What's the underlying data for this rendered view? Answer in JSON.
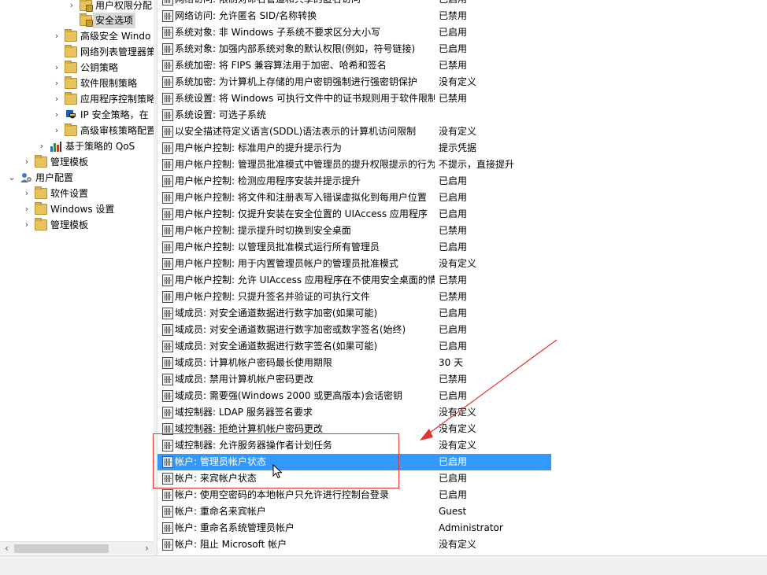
{
  "tree": {
    "items": [
      {
        "label": "用户权限分配",
        "chevron": "›",
        "icon": "lock-folder-icon"
      },
      {
        "label": "安全选项",
        "chevron": "",
        "icon": "lock-folder-icon",
        "selected": true
      },
      {
        "label": "高级安全 Windo",
        "chevron": "›",
        "icon": "folder-icon"
      },
      {
        "label": "网络列表管理器策",
        "chevron": "",
        "icon": "folder-icon"
      },
      {
        "label": "公钥策略",
        "chevron": "›",
        "icon": "folder-icon"
      },
      {
        "label": "软件限制策略",
        "chevron": "›",
        "icon": "folder-icon"
      },
      {
        "label": "应用程序控制策略",
        "chevron": "›",
        "icon": "folder-icon"
      },
      {
        "label": "IP 安全策略，在",
        "chevron": "›",
        "icon": "ipsec-shield-icon"
      },
      {
        "label": "高级审核策略配置",
        "chevron": "›",
        "icon": "folder-icon"
      },
      {
        "label": "基于策略的 QoS",
        "chevron": "›",
        "icon": "qos-chart-icon"
      },
      {
        "label": "管理模板",
        "chevron": "›",
        "icon": "folder-icon"
      },
      {
        "label": "用户配置",
        "chevron": "⌄",
        "icon": "user-config-icon"
      },
      {
        "label": "软件设置",
        "chevron": "›",
        "icon": "folder-icon"
      },
      {
        "label": "Windows 设置",
        "chevron": "›",
        "icon": "folder-icon"
      },
      {
        "label": "管理模板",
        "chevron": "›",
        "icon": "folder-icon"
      }
    ],
    "scroll_left": "‹",
    "scroll_right": "›"
  },
  "policies": [
    {
      "name": "网络访问: 限制对命名管道和共享的匿名访问",
      "value": "已启用"
    },
    {
      "name": "网络访问: 允许匿名 SID/名称转换",
      "value": "已禁用"
    },
    {
      "name": "系统对象: 非 Windows 子系统不要求区分大小写",
      "value": "已启用"
    },
    {
      "name": "系统对象: 加强内部系统对象的默认权限(例如，符号链接)",
      "value": "已启用"
    },
    {
      "name": "系统加密: 将 FIPS 兼容算法用于加密、哈希和签名",
      "value": "已禁用"
    },
    {
      "name": "系统加密: 为计算机上存储的用户密钥强制进行强密钥保护",
      "value": "没有定义"
    },
    {
      "name": "系统设置: 将 Windows 可执行文件中的证书规则用于软件限制策略",
      "value": "已禁用"
    },
    {
      "name": "系统设置: 可选子系统",
      "value": ""
    },
    {
      "name": "以安全描述符定义语言(SDDL)语法表示的计算机访问限制",
      "value": "没有定义"
    },
    {
      "name": "用户帐户控制: 标准用户的提升提示行为",
      "value": "提示凭据"
    },
    {
      "name": "用户帐户控制: 管理员批准模式中管理员的提升权限提示的行为",
      "value": "不提示，直接提升"
    },
    {
      "name": "用户帐户控制: 检测应用程序安装并提示提升",
      "value": "已启用"
    },
    {
      "name": "用户帐户控制: 将文件和注册表写入错误虚拟化到每用户位置",
      "value": "已启用"
    },
    {
      "name": "用户帐户控制: 仅提升安装在安全位置的 UIAccess 应用程序",
      "value": "已启用"
    },
    {
      "name": "用户帐户控制: 提示提升时切换到安全桌面",
      "value": "已禁用"
    },
    {
      "name": "用户帐户控制: 以管理员批准模式运行所有管理员",
      "value": "已启用"
    },
    {
      "name": "用户帐户控制: 用于内置管理员帐户的管理员批准模式",
      "value": "没有定义"
    },
    {
      "name": "用户帐户控制: 允许 UIAccess 应用程序在不使用安全桌面的情况下提升权限",
      "value": "已禁用"
    },
    {
      "name": "用户帐户控制: 只提升签名并验证的可执行文件",
      "value": "已禁用"
    },
    {
      "name": "域成员: 对安全通道数据进行数字加密(如果可能)",
      "value": "已启用"
    },
    {
      "name": "域成员: 对安全通道数据进行数字加密或数字签名(始终)",
      "value": "已启用"
    },
    {
      "name": "域成员: 对安全通道数据进行数字签名(如果可能)",
      "value": "已启用"
    },
    {
      "name": "域成员: 计算机帐户密码最长使用期限",
      "value": "30 天"
    },
    {
      "name": "域成员: 禁用计算机帐户密码更改",
      "value": "已禁用"
    },
    {
      "name": "域成员: 需要强(Windows 2000 或更高版本)会话密钥",
      "value": "已启用"
    },
    {
      "name": "域控制器: LDAP 服务器签名要求",
      "value": "没有定义"
    },
    {
      "name": "域控制器: 拒绝计算机帐户密码更改",
      "value": "没有定义"
    },
    {
      "name": "域控制器: 允许服务器操作者计划任务",
      "value": "没有定义"
    },
    {
      "name": "帐户: 管理员帐户状态",
      "value": "已启用",
      "selected": true
    },
    {
      "name": "帐户: 来宾帐户状态",
      "value": "已启用"
    },
    {
      "name": "帐户: 使用空密码的本地帐户只允许进行控制台登录",
      "value": "已启用"
    },
    {
      "name": "帐户: 重命名来宾帐户",
      "value": "Guest"
    },
    {
      "name": "帐户: 重命名系统管理员帐户",
      "value": "Administrator"
    },
    {
      "name": "帐户: 阻止 Microsoft 帐户",
      "value": "没有定义"
    }
  ],
  "colors": {
    "selection": "#3399ff",
    "annotation": "#e0322f"
  }
}
